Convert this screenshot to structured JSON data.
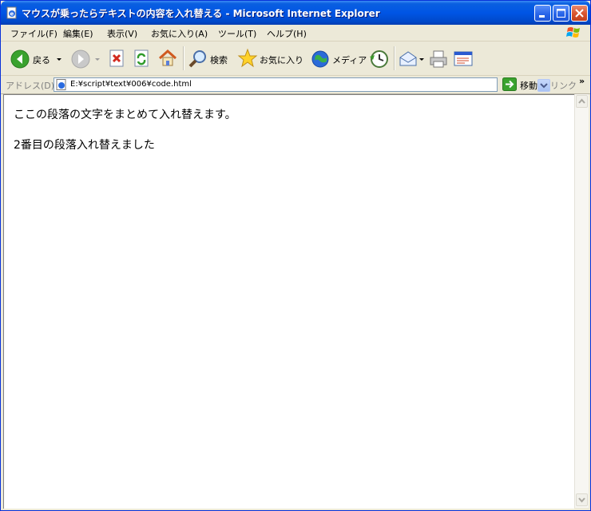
{
  "window": {
    "title": "マウスが乗ったらテキストの内容を入れ替える - Microsoft Internet Explorer"
  },
  "menu": {
    "items": [
      "ファイル(F)",
      "編集(E)",
      "表示(V)",
      "お気に入り(A)",
      "ツール(T)",
      "ヘルプ(H)"
    ]
  },
  "toolbar": {
    "back_label": "戻る",
    "search_label": "検索",
    "favorites_label": "お気に入り",
    "media_label": "メディア"
  },
  "address": {
    "label": "アドレス(D)",
    "value": "E:¥script¥text¥006¥code.html",
    "go_label": "移動",
    "links_label": "リンク"
  },
  "content": {
    "paragraphs": [
      "ここの段落の文字をまとめて入れ替えます。",
      "2番目の段落入れ替えました"
    ]
  },
  "colors": {
    "titlebar": "#0055e5",
    "window_bg": "#ece9d8",
    "close_button": "#d8532e"
  }
}
